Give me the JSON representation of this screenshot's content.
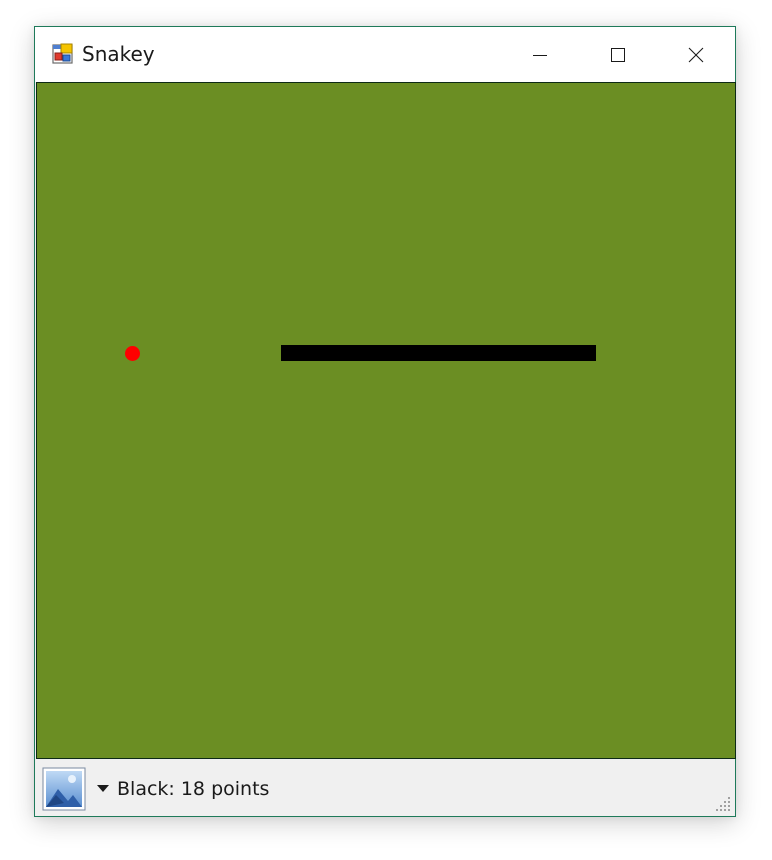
{
  "window": {
    "title": "Snakey",
    "app_icon": "app-window-icon",
    "controls": {
      "minimize": "minimize-icon",
      "maximize": "maximize-icon",
      "close": "close-icon"
    }
  },
  "game": {
    "background_color": "#6b8e23",
    "snake_color": "#000000",
    "food_color": "#ff0000"
  },
  "statusbar": {
    "image_icon": "picture-icon",
    "dropdown_icon": "dropdown-arrow-icon",
    "score_text": "Black: 18 points"
  }
}
